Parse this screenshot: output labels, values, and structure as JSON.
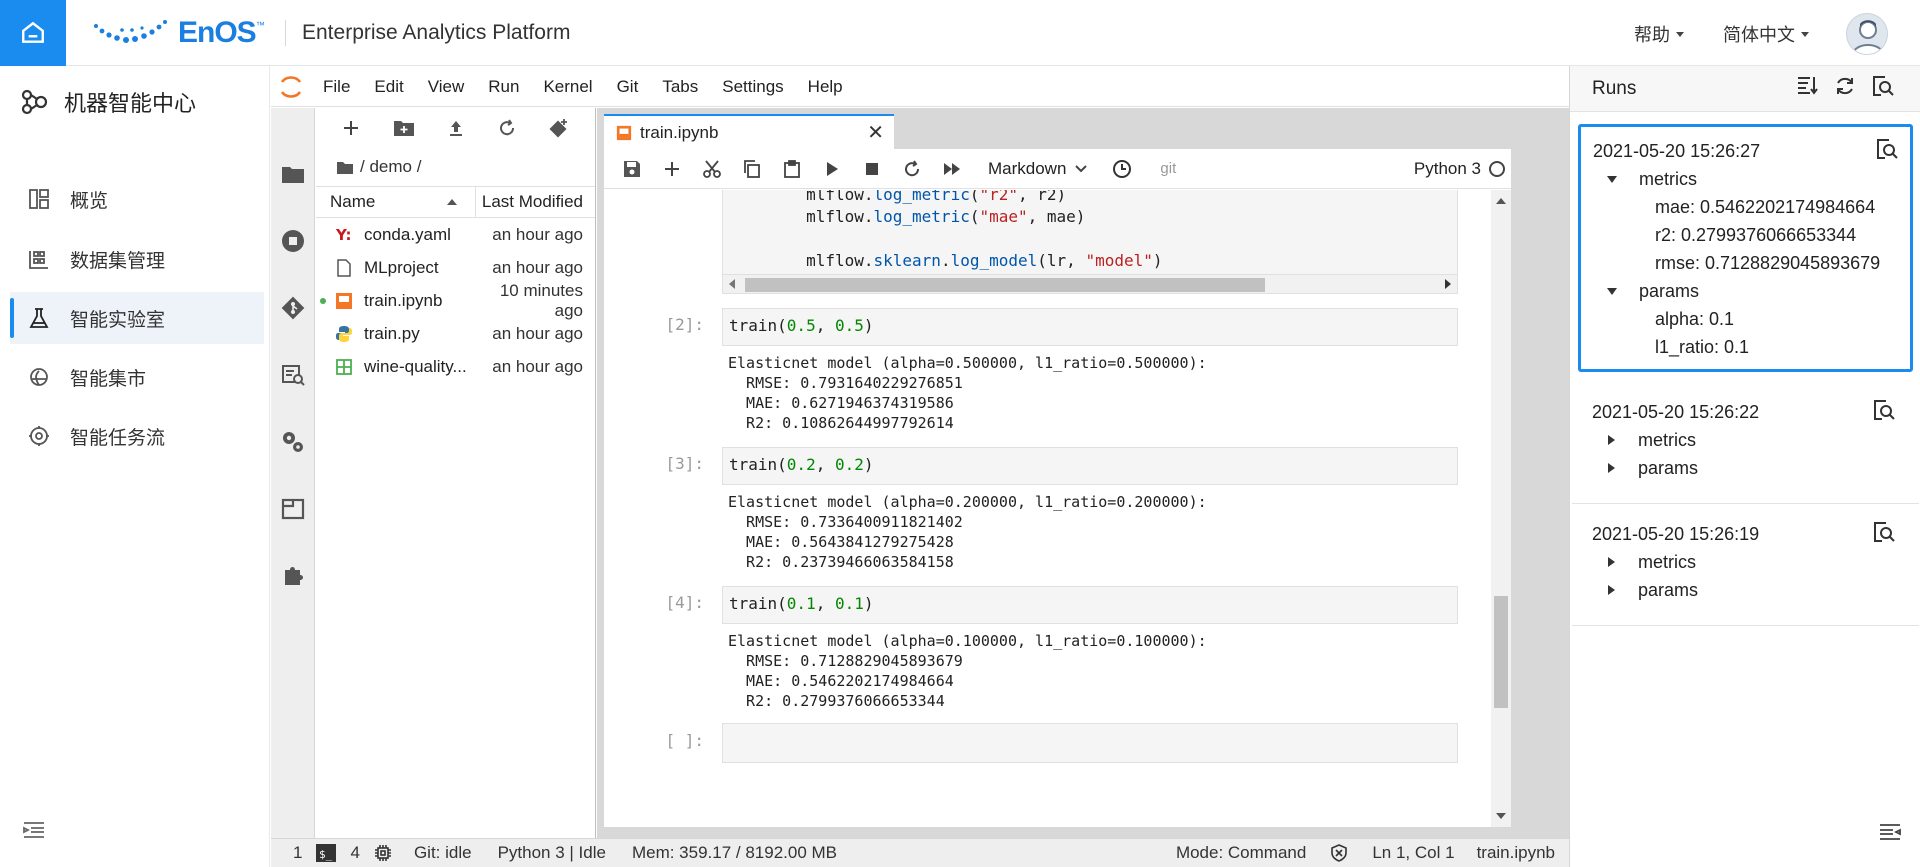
{
  "header": {
    "brand": "EnOS",
    "brand_tm": "™",
    "app_title": "Enterprise Analytics Platform",
    "help_menu": "帮助",
    "language_menu": "简体中文",
    "accent_color": "#1a8cf0"
  },
  "leftnav": {
    "title": "机器智能中心",
    "items": [
      {
        "label": "概览",
        "icon": "dashboard-icon"
      },
      {
        "label": "数据集管理",
        "icon": "dataset-icon"
      },
      {
        "label": "智能实验室",
        "icon": "flask-icon",
        "active": true
      },
      {
        "label": "智能集市",
        "icon": "market-icon"
      },
      {
        "label": "智能任务流",
        "icon": "workflow-icon"
      }
    ]
  },
  "jupyter": {
    "menu": [
      "File",
      "Edit",
      "View",
      "Run",
      "Kernel",
      "Git",
      "Tabs",
      "Settings",
      "Help"
    ],
    "filebrowser": {
      "path": "/ demo /",
      "col_name": "Name",
      "col_modified": "Last Modified",
      "files": [
        {
          "name": "conda.yaml",
          "modified": "an hour ago",
          "icon": "yaml-icon"
        },
        {
          "name": "MLproject",
          "modified": "an hour ago",
          "icon": "file-icon"
        },
        {
          "name": "train.ipynb",
          "modified": "10 minutes ago",
          "icon": "notebook-icon",
          "running": true
        },
        {
          "name": "train.py",
          "modified": "an hour ago",
          "icon": "python-icon"
        },
        {
          "name": "wine-quality...",
          "modified": "an hour ago",
          "icon": "csv-icon"
        }
      ]
    },
    "tab": {
      "label": "train.ipynb"
    },
    "toolbar": {
      "cell_type": "Markdown",
      "git": "git",
      "kernel": "Python 3"
    },
    "cells": {
      "c1_prompt": "[2]:",
      "c2_prompt": "[3]:",
      "c3_prompt": "[4]:",
      "c4_prompt": "[ ]:",
      "c1_out": "Elasticnet model (alpha=0.500000, l1_ratio=0.500000):\n  RMSE: 0.7931640229276851\n  MAE: 0.6271946374319586\n  R2: 0.10862644997792614",
      "c2_out": "Elasticnet model (alpha=0.200000, l1_ratio=0.200000):\n  RMSE: 0.7336400911821402\n  MAE: 0.5643841279275428\n  R2: 0.23739466063584158",
      "c3_out": "Elasticnet model (alpha=0.100000, l1_ratio=0.100000):\n  RMSE: 0.7128829045893679\n  MAE: 0.5462202174984664\n  R2: 0.2799376066653344"
    },
    "statusbar": {
      "terminals": "1",
      "kernels": "4",
      "git": "Git: idle",
      "kernel_status": "Python 3 | Idle",
      "mem": "Mem: 359.17 / 8192.00 MB",
      "mode": "Mode: Command",
      "position": "Ln 1, Col 1",
      "file": "train.ipynb"
    }
  },
  "runs": {
    "title": "Runs",
    "items": [
      {
        "time": "2021-05-20 15:26:27",
        "metrics_label": "metrics",
        "params_label": "params",
        "metrics": [
          "mae: 0.5462202174984664",
          "r2: 0.2799376066653344",
          "rmse: 0.7128829045893679"
        ],
        "params": [
          "alpha: 0.1",
          "l1_ratio: 0.1"
        ]
      },
      {
        "time": "2021-05-20 15:26:22",
        "metrics_label": "metrics",
        "params_label": "params"
      },
      {
        "time": "2021-05-20 15:26:19",
        "metrics_label": "metrics",
        "params_label": "params"
      }
    ]
  }
}
